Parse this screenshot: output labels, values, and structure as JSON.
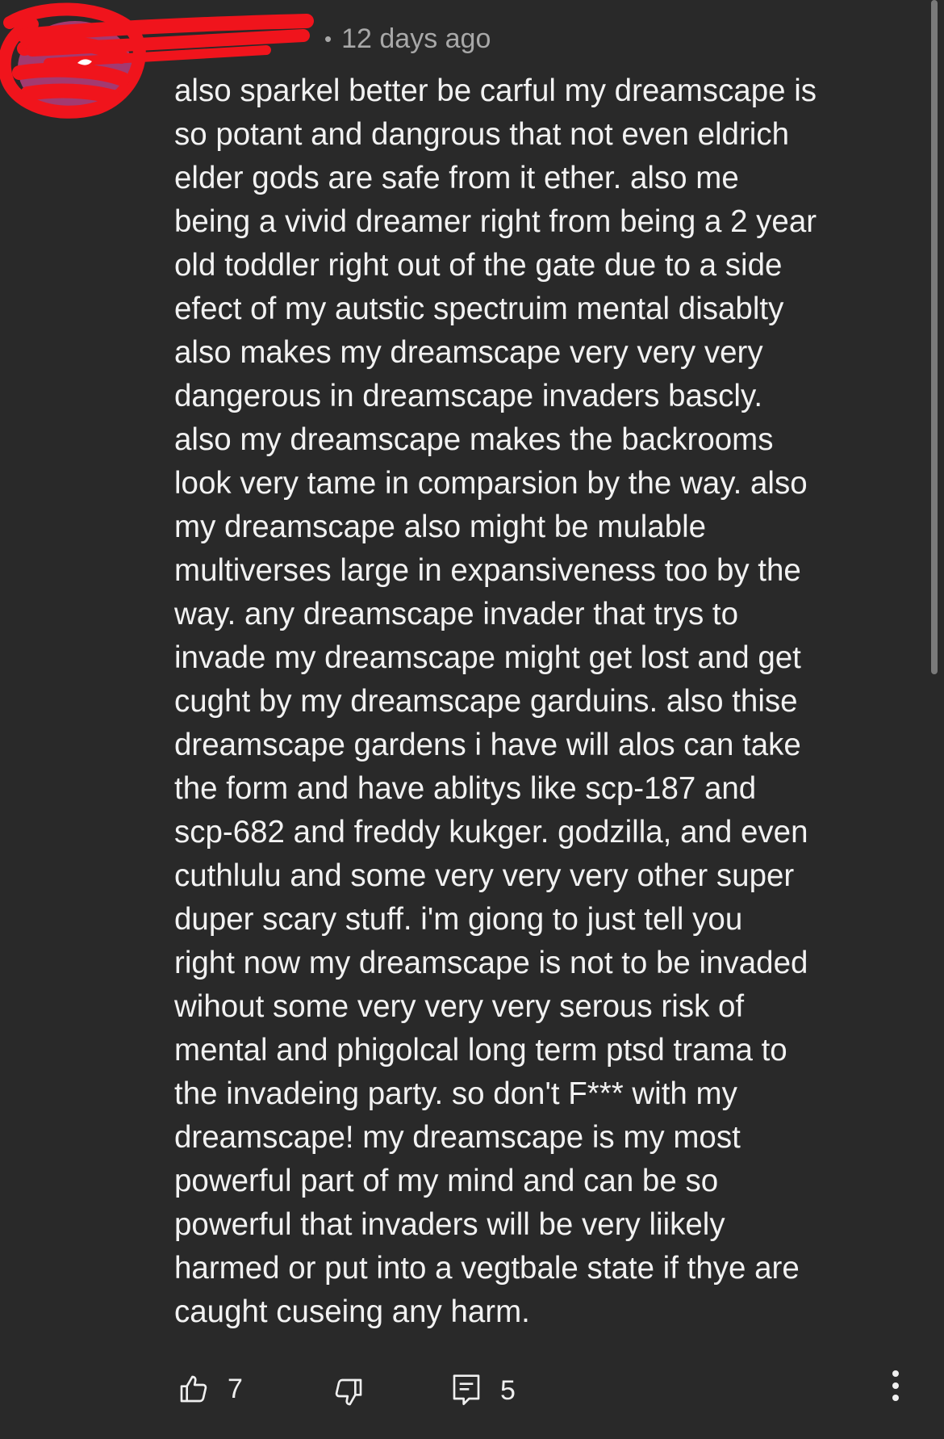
{
  "comment": {
    "author": "",
    "separator": "•",
    "timestamp": "12 days ago",
    "text": "also sparkel better be carful my dreamscape is\nso potant and dangrous that not even eldrich\nelder gods are safe from it ether. also me\nbeing a vivid dreamer right from being a 2 year\nold toddler right out of the gate due to a side\nefect of my autstic spectruim mental disablty\nalso makes my dreamscape very very very\ndangerous in dreamscape invaders bascly.\nalso my dreamscape makes the backrooms\nlook very tame in comparsion by the way. also\nmy dreamscape also might be mulable\nmultiverses large in expansiveness too by the\nway. any dreamscape invader that trys to\ninvade my dreamscape might get lost and get\ncught by my dreamscape garduins. also thise\ndreamscape gardens i have will alos can take\nthe form and have ablitys like scp-187 and\nscp-682 and freddy kukger. godzilla, and even\ncuthlulu and some very very very other super\nduper scary stuff. i'm giong to just tell you\nright now my dreamscape is not to be invaded\nwihout some very very very serous risk of\nmental and phigolcal long term ptsd trama to\nthe invadeing party. so don't F*** with my\ndreamscape! my dreamscape is my most\npowerful part of my mind and can be so\npowerful that invaders will be very liikely\nharmed or put into a vegtbale state if thye are\ncaught cuseing any harm."
  },
  "actions": {
    "like_count": "7",
    "reply_count": "5"
  },
  "icons": {
    "like": "thumbs-up-icon",
    "dislike": "thumbs-down-icon",
    "reply": "reply-icon",
    "more": "more-vert-icon"
  },
  "colors": {
    "background": "#292929",
    "text": "#f2f2f2",
    "meta": "#a8a8a8",
    "redaction": "#f0141c"
  }
}
